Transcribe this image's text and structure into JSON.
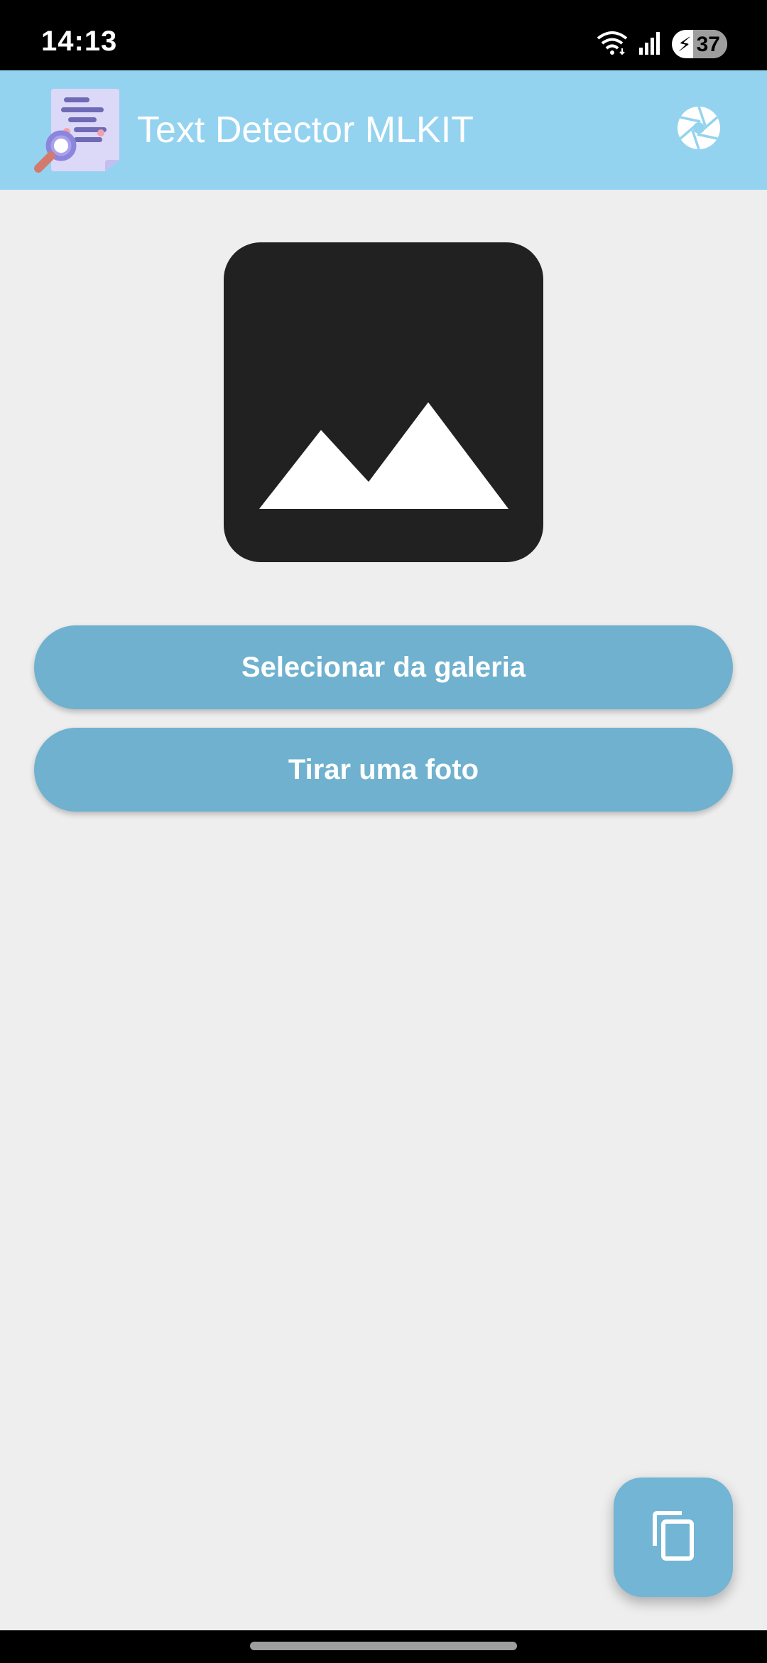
{
  "status_bar": {
    "time": "14:13",
    "battery_level": "37",
    "icons": [
      "wifi-icon",
      "signal-icon",
      "battery-charging-icon"
    ]
  },
  "app_bar": {
    "title": "Text Detector MLKIT",
    "logo_icon": "document-search-icon",
    "action_icon": "camera-aperture-icon",
    "background_color": "#94d3ef"
  },
  "main": {
    "image_placeholder_icon": "image-icon",
    "buttons": {
      "gallery_label": "Selecionar da galeria",
      "camera_label": "Tirar uma foto"
    },
    "button_color": "#6fb1cf"
  },
  "fab": {
    "icon": "copy-icon"
  }
}
